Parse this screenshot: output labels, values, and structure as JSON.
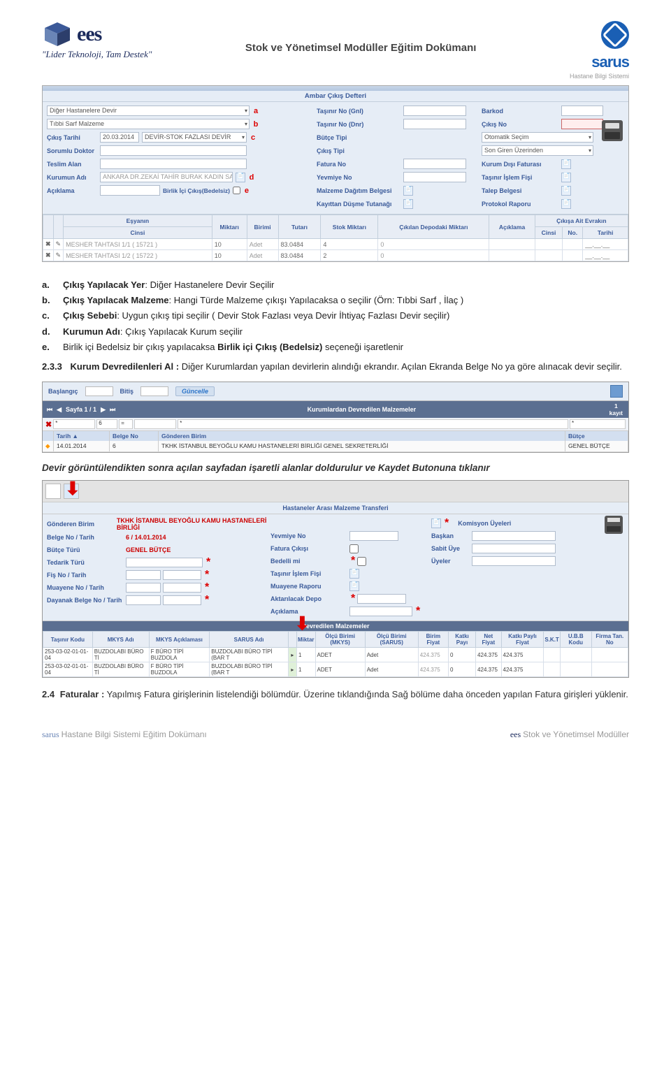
{
  "header": {
    "ees_brand": "ees",
    "tagline": "\"Lider Teknoloji, Tam Destek\"",
    "doc_title": "Stok ve Yönetimsel Modüller Eğitim Dokümanı",
    "sarus_brand": "sarus",
    "sarus_sub": "Hastane Bilgi Sistemi"
  },
  "ss1": {
    "title": "Ambar Çıkış Defteri",
    "left": {
      "dropdown1": "Diğer Hastanelere Devir",
      "dropdown2": "Tıbbi Sarf Malzeme",
      "cikis_tarihi_lbl": "Çıkış Tarihi",
      "cikis_tarihi_val": "20.03.2014",
      "devir_sebep": "DEVİR-STOK FAZLASI DEVİR",
      "sorumlu_lbl": "Sorumlu Doktor",
      "teslim_lbl": "Teslim Alan",
      "kurum_lbl": "Kurumun Adı",
      "kurum_val": "ANKARA DR.ZEKAİ TAHİR BURAK KADIN SAĞLIĞI EĞ",
      "aciklama_lbl": "Açıklama",
      "birlik_lbl": "Birlik İçi Çıkış(Bedelsiz)"
    },
    "letters": {
      "a": "a",
      "b": "b",
      "c": "c",
      "d": "d",
      "e": "e"
    },
    "mid": {
      "tasinir_gnl": "Taşınır No (Gnl)",
      "tasinir_dnr": "Taşınır No (Dnr)",
      "butce_tipi": "Bütçe Tipi",
      "cikis_tipi": "Çıkış Tipi",
      "fatura_no": "Fatura No",
      "yevmiye_no": "Yevmiye No",
      "malzeme_dag": "Malzeme Dağıtım Belgesi",
      "kayittan": "Kayıttan Düşme Tutanağı",
      "butce_val": "Otomatik Seçim",
      "cikis_val": "Son Giren Üzerinden"
    },
    "right": {
      "barkod": "Barkod",
      "cikis_no": "Çıkış No",
      "kurum_disi": "Kurum Dışı Faturası",
      "tasinir_fis": "Taşınır İşlem Fişi",
      "talep": "Talep Belgesi",
      "protokol": "Protokol Raporu"
    },
    "table": {
      "h_esyanin": "Eşyanın",
      "h_cinsi": "Cinsi",
      "h_miktari": "Miktarı",
      "h_birimi": "Birimi",
      "h_tutari": "Tutarı",
      "h_stok": "Stok Miktarı",
      "h_cikilan": "Çıkılan Depodaki Miktarı",
      "h_aciklama": "Açıklama",
      "h_evrak": "Çıkışa Ait Evrakın",
      "h_cinsi2": "Cinsi",
      "h_no": "No.",
      "h_tarihi": "Tarihi",
      "rows": [
        {
          "cins": "MESHER TAHTASI 1/1 ( 15721 )",
          "mik": "10",
          "bir": "Adet",
          "tut": "83.0484",
          "stok": "4",
          "dep": "0"
        },
        {
          "cins": "MESHER TAHTASI 1/2 ( 15722 )",
          "mik": "10",
          "bir": "Adet",
          "tut": "83.0484",
          "stok": "2",
          "dep": "0"
        }
      ]
    }
  },
  "text": {
    "a_key": "a.",
    "a_lbl": "Çıkış Yapılacak Yer",
    "a_rest": ": Diğer Hastanelere Devir Seçilir",
    "b_key": "b.",
    "b_lbl": "Çıkış Yapılacak Malzeme",
    "b_rest": ": Hangi Türde Malzeme çıkışı Yapılacaksa o seçilir (Örn: Tıbbi Sarf , İlaç )",
    "c_key": "c.",
    "c_lbl": "Çıkış Sebebi",
    "c_rest": ": Uygun çıkış tipi seçilir ( Devir  Stok Fazlası veya Devir İhtiyaç Fazlası Devir seçilir)",
    "d_key": "d.",
    "d_lbl": "Kurumun Adı",
    "d_rest": ": Çıkış Yapılacak Kurum seçilir",
    "e_key": "e.",
    "e_rest_pre": "Birlik içi Bedelsiz bir çıkış yapılacaksa ",
    "e_rest_bold": "Birlik içi Çıkış (Bedelsiz)",
    "e_rest_post": " seçeneği işaretlenir",
    "p233_num": "2.3.3",
    "p233_bold": "Kurum Devredilenleri Al :",
    "p233_rest": " Diğer Kurumlardan yapılan devirlerin alındığı ekrandır. Açılan Ekranda Belge No ya göre alınacak devir seçilir."
  },
  "ss2": {
    "baslangic": "Başlangıç",
    "bitis": "Bitiş",
    "guncelle": "Güncelle",
    "band_title": "Kurumlardan Devredilen Malzemeler",
    "pager": "Sayfa 1 / 1",
    "count1": "1",
    "count2": "kayıt",
    "f1": "*",
    "f2": "6",
    "f3": "=",
    "f4": "*",
    "f5": "*",
    "h_tarih": "Tarih ▲",
    "h_belge": "Belge No",
    "h_gonderen": "Gönderen Birim",
    "h_butce": "Bütçe",
    "r_tarih": "14.01.2014",
    "r_belge": "6",
    "r_gond": "TKHK İSTANBUL BEYOĞLU KAMU HASTANELERİ BİRLİĞİ GENEL SEKRETERLİĞİ",
    "r_butce": "GENEL BÜTÇE"
  },
  "midtext": "Devir görüntülendikten sonra açılan sayfadan işaretli alanlar doldurulur ve Kaydet Butonuna tıklanır",
  "ss3": {
    "title": "Hastaneler Arası Malzeme Transferi",
    "c1": {
      "gond_lbl": "Gönderen Birim",
      "gond_val": "TKHK İSTANBUL BEYOĞLU KAMU HASTANELERİ BİRLİĞİ",
      "belge_lbl": "Belge No / Tarih",
      "belge_val": "6 / 14.01.2014",
      "butce_lbl": "Bütçe Türü",
      "butce_val": "GENEL BÜTÇE",
      "tedarik_lbl": "Tedarik Türü",
      "fis_lbl": "Fiş No / Tarih",
      "muayene_lbl": "Muayene No / Tarih",
      "dayanak_lbl": "Dayanak Belge No / Tarih"
    },
    "c2": {
      "yevmiye": "Yevmiye No",
      "fatura": "Fatura Çıkışı",
      "bedelli": "Bedelli mi",
      "tasinir": "Taşınır İşlem Fişi",
      "muayene_r": "Muayene Raporu",
      "aktarilacak": "Aktarılacak Depo",
      "aciklama": "Açıklama"
    },
    "c3": {
      "komisyon": "Komisyon Üyeleri",
      "baskan": "Başkan",
      "sabit": "Sabit Üye",
      "uyeler": "Üyeler"
    },
    "band": "Devredilen Malzemeler",
    "th": {
      "tasinir": "Taşınır Kodu",
      "mkys_adi": "MKYS Adı",
      "mkys_acik": "MKYS Açıklaması",
      "sarus": "SARUS Adı",
      "miktar": "Miktar",
      "obirim_m": "Ölçü Birimi (MKYS)",
      "obirim_s": "Ölçü Birimi (SARUS)",
      "bf": "Birim Fiyat",
      "katki": "Katkı Payı",
      "net": "Net Fiyat",
      "katkif": "Katkı Paylı Fiyat",
      "skt": "S.K.T",
      "ubb": "U.B.B Kodu",
      "firma": "Firma Tan. No"
    },
    "rows": [
      {
        "kod": "253-03-02-01-01-04",
        "mkys": "BUZDOLABI BÜRO Tİ",
        "ack": "F BÜRO TİPİ BUZDOLA",
        "sar": "BUZDOLABI BÜRO TİPİ (BAR T",
        "mik": "1",
        "obm": "ADET",
        "obs": "Adet",
        "bf": "424.375",
        "kat": "0",
        "net": "424.375",
        "katf": "424.375"
      },
      {
        "kod": "253-03-02-01-01-04",
        "mkys": "BUZDOLABI BÜRO Tİ",
        "ack": "F BÜRO TİPİ BUZDOLA",
        "sar": "BUZDOLABI BÜRO TİPİ (BAR T",
        "mik": "1",
        "obm": "ADET",
        "obs": "Adet",
        "bf": "424.375",
        "kat": "0",
        "net": "424.375",
        "katf": "424.375"
      }
    ]
  },
  "foot24": {
    "num": "2.4",
    "bold": "Faturalar :",
    "rest": " Yapılmış Fatura girişlerinin listelendiği bölümdür. Üzerine tıklandığında Sağ bölüme daha önceden yapılan Fatura girişleri yüklenir."
  },
  "footer": {
    "left_pre": "sarus ",
    "left_rest": "Hastane Bilgi Sistemi Eğitim Dokümanı",
    "right_pre": "ees ",
    "right_rest": "Stok ve Yönetimsel Modüller"
  }
}
